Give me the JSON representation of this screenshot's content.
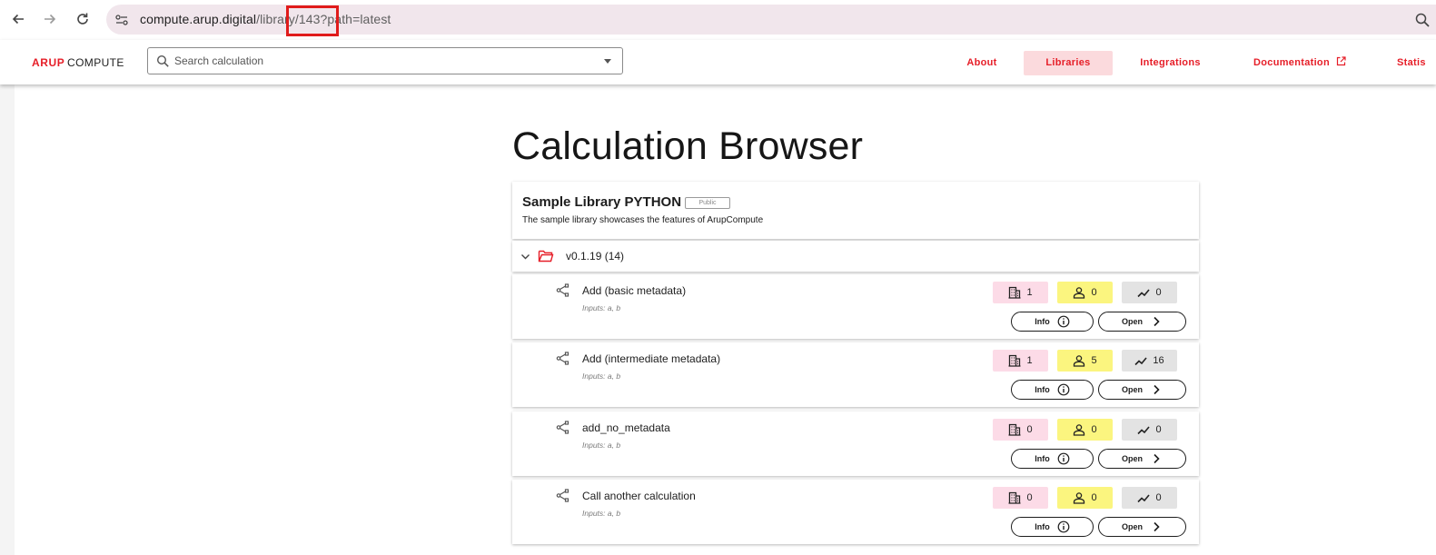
{
  "browser": {
    "url_host": "compute.arup.digital",
    "url_path": "/library/143?path=latest",
    "icons": {
      "back": "arrow-left-icon",
      "forward": "arrow-right-icon",
      "reload": "reload-icon",
      "site_info": "tune-icon",
      "zoom": "zoom-icon"
    }
  },
  "header": {
    "logo_arup": "ARUP",
    "logo_compute": "COMPUTE",
    "search_placeholder": "Search calculation",
    "nav": [
      {
        "label": "About",
        "active": false
      },
      {
        "label": "Libraries",
        "active": true
      },
      {
        "label": "Integrations",
        "active": false
      },
      {
        "label": "Documentation",
        "active": false,
        "external": true
      },
      {
        "label": "Statis",
        "active": false
      }
    ]
  },
  "colors": {
    "accent": "#e61e28",
    "active_tab_bg": "#fbdadd",
    "org_badge": "#fcdbe7",
    "user_badge": "#fbf57f",
    "runs_badge": "#e3e3e3"
  },
  "page": {
    "title": "Calculation Browser",
    "library": {
      "name": "Sample Library PYTHON",
      "visibility": "Public",
      "description": "The sample library showcases the features of ArupCompute"
    },
    "version": {
      "label": "v0.1.19 (14)"
    },
    "info_label": "Info",
    "open_label": "Open",
    "calculations": [
      {
        "name": "Add (basic metadata)",
        "inputs": "Inputs: a, b",
        "orgs": "1",
        "users": "0",
        "runs": "0"
      },
      {
        "name": "Add (intermediate metadata)",
        "inputs": "Inputs: a, b",
        "orgs": "1",
        "users": "5",
        "runs": "16"
      },
      {
        "name": "add_no_metadata",
        "inputs": "Inputs: a, b",
        "orgs": "0",
        "users": "0",
        "runs": "0"
      },
      {
        "name": "Call another calculation",
        "inputs": "Inputs: a, b",
        "orgs": "0",
        "users": "0",
        "runs": "0"
      }
    ]
  }
}
